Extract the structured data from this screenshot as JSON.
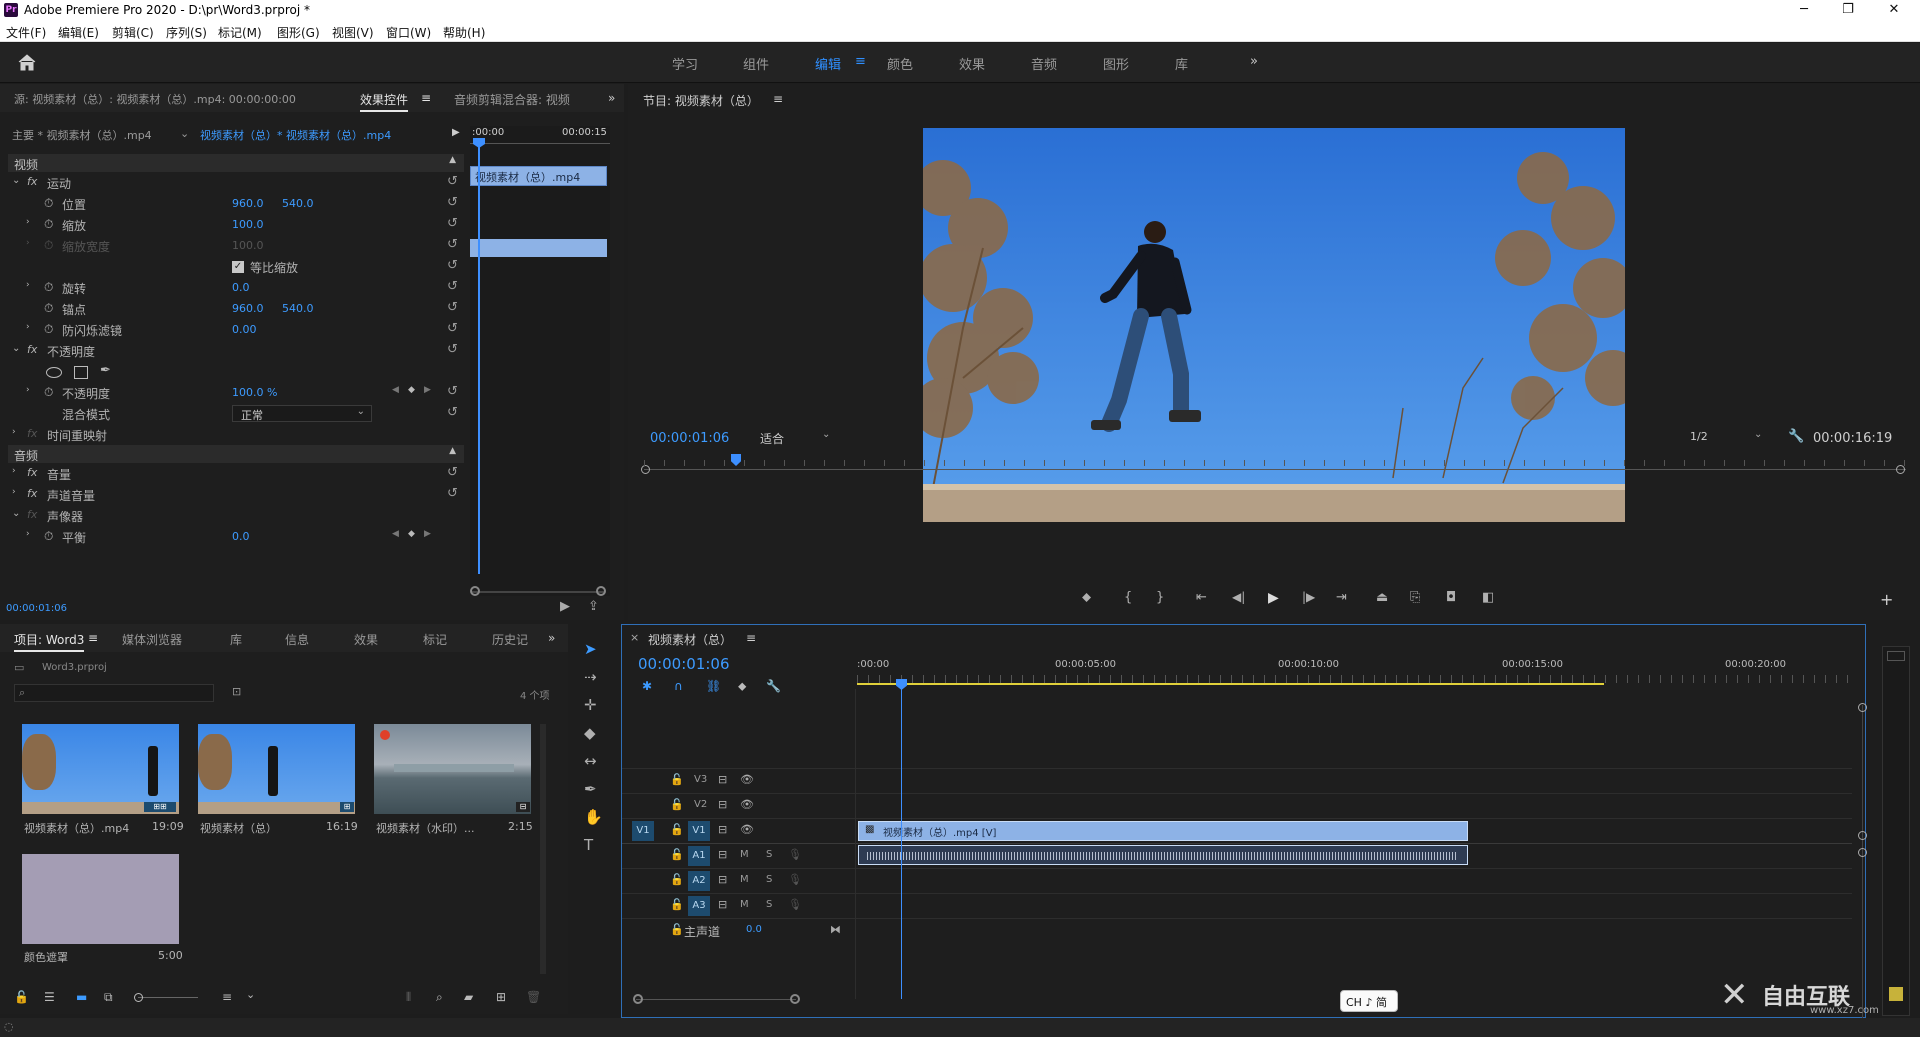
{
  "app": {
    "title": "Adobe Premiere Pro 2020 - D:\\pr\\Word3.prproj *",
    "icon_label": "Pr"
  },
  "menu": [
    "文件(F)",
    "编辑(E)",
    "剪辑(C)",
    "序列(S)",
    "标记(M)",
    "图形(G)",
    "视图(V)",
    "窗口(W)",
    "帮助(H)"
  ],
  "workspaces": {
    "items": [
      "学习",
      "组件",
      "编辑",
      "颜色",
      "效果",
      "音频",
      "图形",
      "库"
    ],
    "active": "编辑",
    "more": "»"
  },
  "source_panel": {
    "tabs": [
      "源: 视频素材（总）: 视频素材（总）.mp4: 00:00:00:00",
      "效果控件",
      "音频剪辑混合器: 视频"
    ],
    "active_tab": "效果控件",
    "master_label": "主要 * 视频素材（总）.mp4",
    "clip_label": "视频素材（总）* 视频素材（总）.mp4",
    "ruler_start": ":00:00",
    "ruler_end": "00:00:15",
    "mini_clip": "视频素材（总）.mp4",
    "section_video": "视频",
    "section_audio": "音频",
    "motion": "运动",
    "position_label": "位置",
    "position_x": "960.0",
    "position_y": "540.0",
    "scale_label": "缩放",
    "scale_value": "100.0",
    "scale_width_label": "缩放宽度",
    "scale_width_value": "100.0",
    "uniform_scale": "等比缩放",
    "rotation_label": "旋转",
    "rotation_value": "0.0",
    "anchor_label": "锚点",
    "anchor_x": "960.0",
    "anchor_y": "540.0",
    "antiflicker_label": "防闪烁滤镜",
    "antiflicker_value": "0.00",
    "opacity_group": "不透明度",
    "opacity_label": "不透明度",
    "opacity_value": "100.0 %",
    "blend_label": "混合模式",
    "blend_value": "正常",
    "time_remap": "时间重映射",
    "volume": "音量",
    "channel_volume": "声道音量",
    "panner": "声像器",
    "balance_label": "平衡",
    "balance_value": "0.0",
    "timecode": "00:00:01:06"
  },
  "program": {
    "title": "节目: 视频素材（总）",
    "timecode": "00:00:01:06",
    "fit": "适合",
    "resolution": "1/2",
    "duration": "00:00:16:19"
  },
  "project": {
    "tabs": [
      "项目: Word3",
      "媒体浏览器",
      "库",
      "信息",
      "效果",
      "标记",
      "历史记"
    ],
    "active_tab": "项目: Word3",
    "file": "Word3.prproj",
    "count": "4 个项",
    "items": [
      {
        "name": "视频素材（总）.mp4",
        "duration": "19:09"
      },
      {
        "name": "视频素材（总）",
        "duration": "16:19"
      },
      {
        "name": "视频素材（水印）...",
        "duration": "2:15"
      },
      {
        "name": "颜色遮罩",
        "duration": "5:00"
      }
    ]
  },
  "timeline": {
    "title": "视频素材（总）",
    "timecode": "00:00:01:06",
    "ruler": [
      ":00:00",
      "00:00:05:00",
      "00:00:10:00",
      "00:00:15:00",
      "00:00:20:00"
    ],
    "tracks_video": [
      "V3",
      "V2",
      "V1"
    ],
    "tracks_audio": [
      "A1",
      "A2",
      "A3"
    ],
    "master_label": "主声道",
    "master_value": "0.0",
    "clip_label": "视频素材（总）.mp4 [V]",
    "m": "M",
    "s": "S"
  },
  "ime": "CH ♪ 简",
  "watermark": "自由互联",
  "watermark_url": "www.xz7.com",
  "colors": {
    "accent": "#2f8fff",
    "clip_video": "#8db2e6",
    "clip_audio": "#2e3b52",
    "sky": "#2f78d6"
  }
}
